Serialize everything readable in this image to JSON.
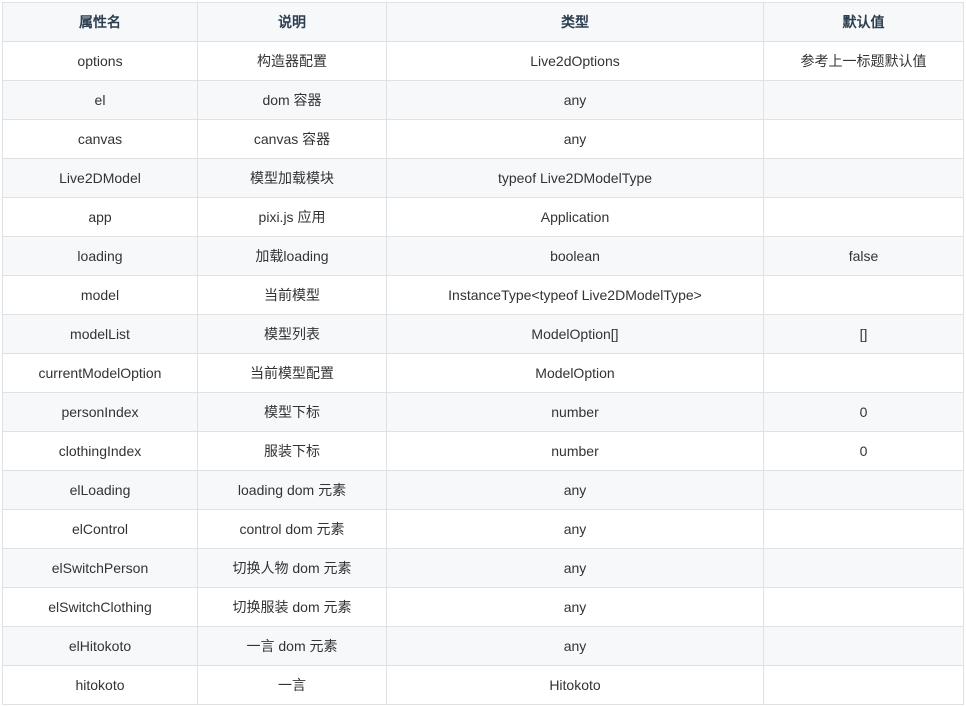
{
  "table": {
    "headers": [
      "属性名",
      "说明",
      "类型",
      "默认值"
    ],
    "rows": [
      [
        "options",
        "构造器配置",
        "Live2dOptions",
        "参考上一标题默认值"
      ],
      [
        "el",
        "dom 容器",
        "any",
        ""
      ],
      [
        "canvas",
        "canvas 容器",
        "any",
        ""
      ],
      [
        "Live2DModel",
        "模型加载模块",
        "typeof Live2DModelType",
        ""
      ],
      [
        "app",
        "pixi.js 应用",
        "Application",
        ""
      ],
      [
        "loading",
        "加载loading",
        "boolean",
        "false"
      ],
      [
        "model",
        "当前模型",
        "InstanceType<typeof Live2DModelType>",
        ""
      ],
      [
        "modelList",
        "模型列表",
        "ModelOption[]",
        "[]"
      ],
      [
        "currentModelOption",
        "当前模型配置",
        "ModelOption",
        ""
      ],
      [
        "personIndex",
        "模型下标",
        "number",
        "0"
      ],
      [
        "clothingIndex",
        "服装下标",
        "number",
        "0"
      ],
      [
        "elLoading",
        "loading dom 元素",
        "any",
        ""
      ],
      [
        "elControl",
        "control dom 元素",
        "any",
        ""
      ],
      [
        "elSwitchPerson",
        "切换人物 dom 元素",
        "any",
        ""
      ],
      [
        "elSwitchClothing",
        "切换服装 dom 元素",
        "any",
        ""
      ],
      [
        "elHitokoto",
        "一言 dom 元素",
        "any",
        ""
      ],
      [
        "hitokoto",
        "一言",
        "Hitokoto",
        ""
      ]
    ]
  }
}
